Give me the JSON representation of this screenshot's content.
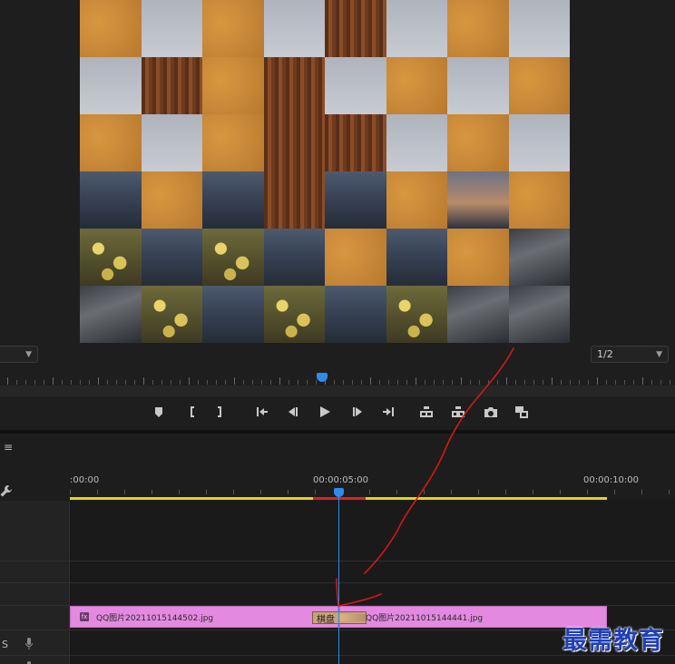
{
  "monitor": {
    "zoom_value": "",
    "resolution_value": "1/2",
    "preview_tiles": [
      "wall",
      "sky",
      "wall",
      "sky",
      "wood",
      "sky",
      "wall",
      "sky",
      "sky",
      "wood",
      "wall",
      "wood",
      "sky",
      "wall",
      "sky",
      "wall",
      "wall",
      "sky",
      "wall",
      "wood",
      "wood",
      "sky",
      "wall",
      "sky",
      "city",
      "wall",
      "city",
      "wood",
      "city",
      "wall",
      "sunset",
      "wall",
      "flower",
      "city",
      "flower",
      "city",
      "wall",
      "city",
      "wall",
      "rail",
      "rail",
      "flower",
      "city",
      "flower",
      "city",
      "flower",
      "rail",
      "rail"
    ]
  },
  "transport": {
    "buttons": [
      {
        "name": "add-marker-button",
        "icon": "marker-icon"
      },
      {
        "name": "mark-in-button",
        "icon": "mark-in-icon"
      },
      {
        "name": "mark-out-button",
        "icon": "mark-out-icon"
      },
      {
        "name": "go-to-in-button",
        "icon": "go-to-in-icon"
      },
      {
        "name": "step-back-button",
        "icon": "step-back-icon"
      },
      {
        "name": "play-button",
        "icon": "play-icon"
      },
      {
        "name": "step-forward-button",
        "icon": "step-forward-icon"
      },
      {
        "name": "go-to-out-button",
        "icon": "go-to-out-icon"
      },
      {
        "name": "lift-button",
        "icon": "lift-icon"
      },
      {
        "name": "extract-button",
        "icon": "extract-icon"
      },
      {
        "name": "export-frame-button",
        "icon": "camera-icon"
      },
      {
        "name": "comparison-view-button",
        "icon": "compare-icon"
      }
    ]
  },
  "timeline": {
    "menu_glyph": "≡",
    "timecodes": [
      ":00:00",
      "00:00:05:00",
      "00:00:10:00"
    ],
    "clips": [
      {
        "label": "QQ图片20211015144502.jpg",
        "fx": "fx"
      },
      {
        "label": "QQ图片20211015144441.jpg",
        "fx": "fx"
      }
    ],
    "transition_label": "棋盘",
    "audio_track_label": "S"
  },
  "watermark": "最需教育",
  "colors": {
    "playhead": "#2d8ceb",
    "clip": "#e38ae0",
    "work_area": "#e5d31a",
    "render_bar": "#d22222",
    "annotation": "#d41818",
    "watermark": "#1f3fb8"
  }
}
